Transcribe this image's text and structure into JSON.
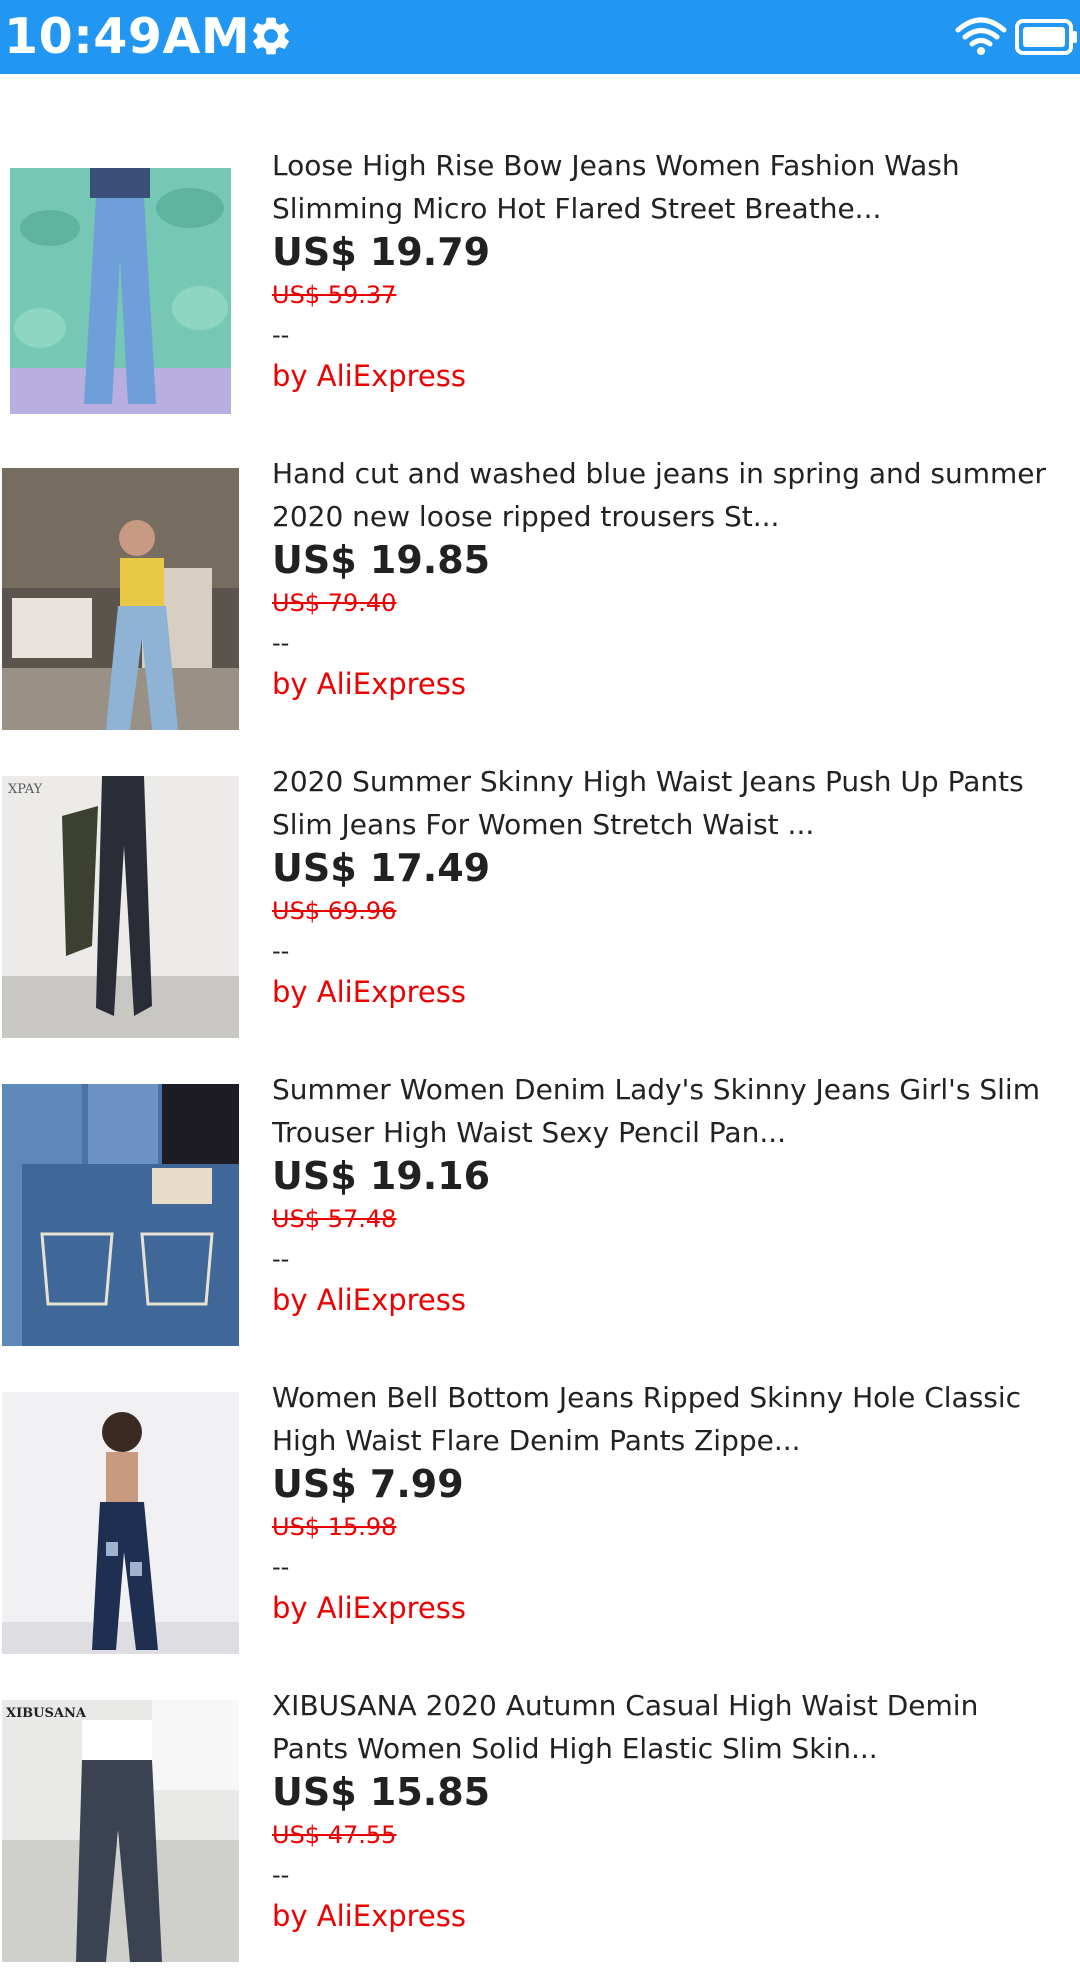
{
  "status_bar": {
    "time": "10:49AM",
    "icons": [
      "gear-icon",
      "wifi-icon",
      "battery-icon"
    ],
    "background": "#2196f3"
  },
  "colors": {
    "accent": "#2196f3",
    "sale": "#ee0000",
    "price": "#212121"
  },
  "products": [
    {
      "title_line1": "Loose High Rise Bow Jeans Women Fashion Wash",
      "title_line2": "Slimming Micro Hot Flared Street Breathe...",
      "price": "US$ 19.79",
      "original_price": "US$ 59.37",
      "rating": "--",
      "seller": "by AliExpress"
    },
    {
      "title_line1": "Hand cut and washed blue jeans in spring and summer",
      "title_line2": "2020 new loose ripped trousers St...",
      "price": "US$ 19.85",
      "original_price": "US$ 79.40",
      "rating": "--",
      "seller": "by AliExpress"
    },
    {
      "title_line1": "2020 Summer Skinny High Waist Jeans Push Up Pants",
      "title_line2": "Slim Jeans For Women Stretch Waist ...",
      "price": "US$ 17.49",
      "original_price": "US$ 69.96",
      "rating": "--",
      "seller": "by AliExpress",
      "image_text": "XPAY"
    },
    {
      "title_line1": "Summer Women Denim Lady's Skinny Jeans Girl's Slim",
      "title_line2": "Trouser High Waist Sexy Pencil Pan...",
      "price": "US$ 19.16",
      "original_price": "US$ 57.48",
      "rating": "--",
      "seller": "by AliExpress"
    },
    {
      "title_line1": "Women Bell Bottom Jeans Ripped Skinny Hole Classic",
      "title_line2": "High Waist Flare Denim Pants Zippe...",
      "price": "US$ 7.99",
      "original_price": "US$ 15.98",
      "rating": "--",
      "seller": "by AliExpress"
    },
    {
      "title_line1": "XIBUSANA 2020 Autumn Casual High Waist Demin",
      "title_line2": "Pants Women Solid High Elastic Slim Skin...",
      "price": "US$ 15.85",
      "original_price": "US$ 47.55",
      "rating": "--",
      "seller": "by AliExpress",
      "image_text": "XIBUSANA"
    }
  ]
}
